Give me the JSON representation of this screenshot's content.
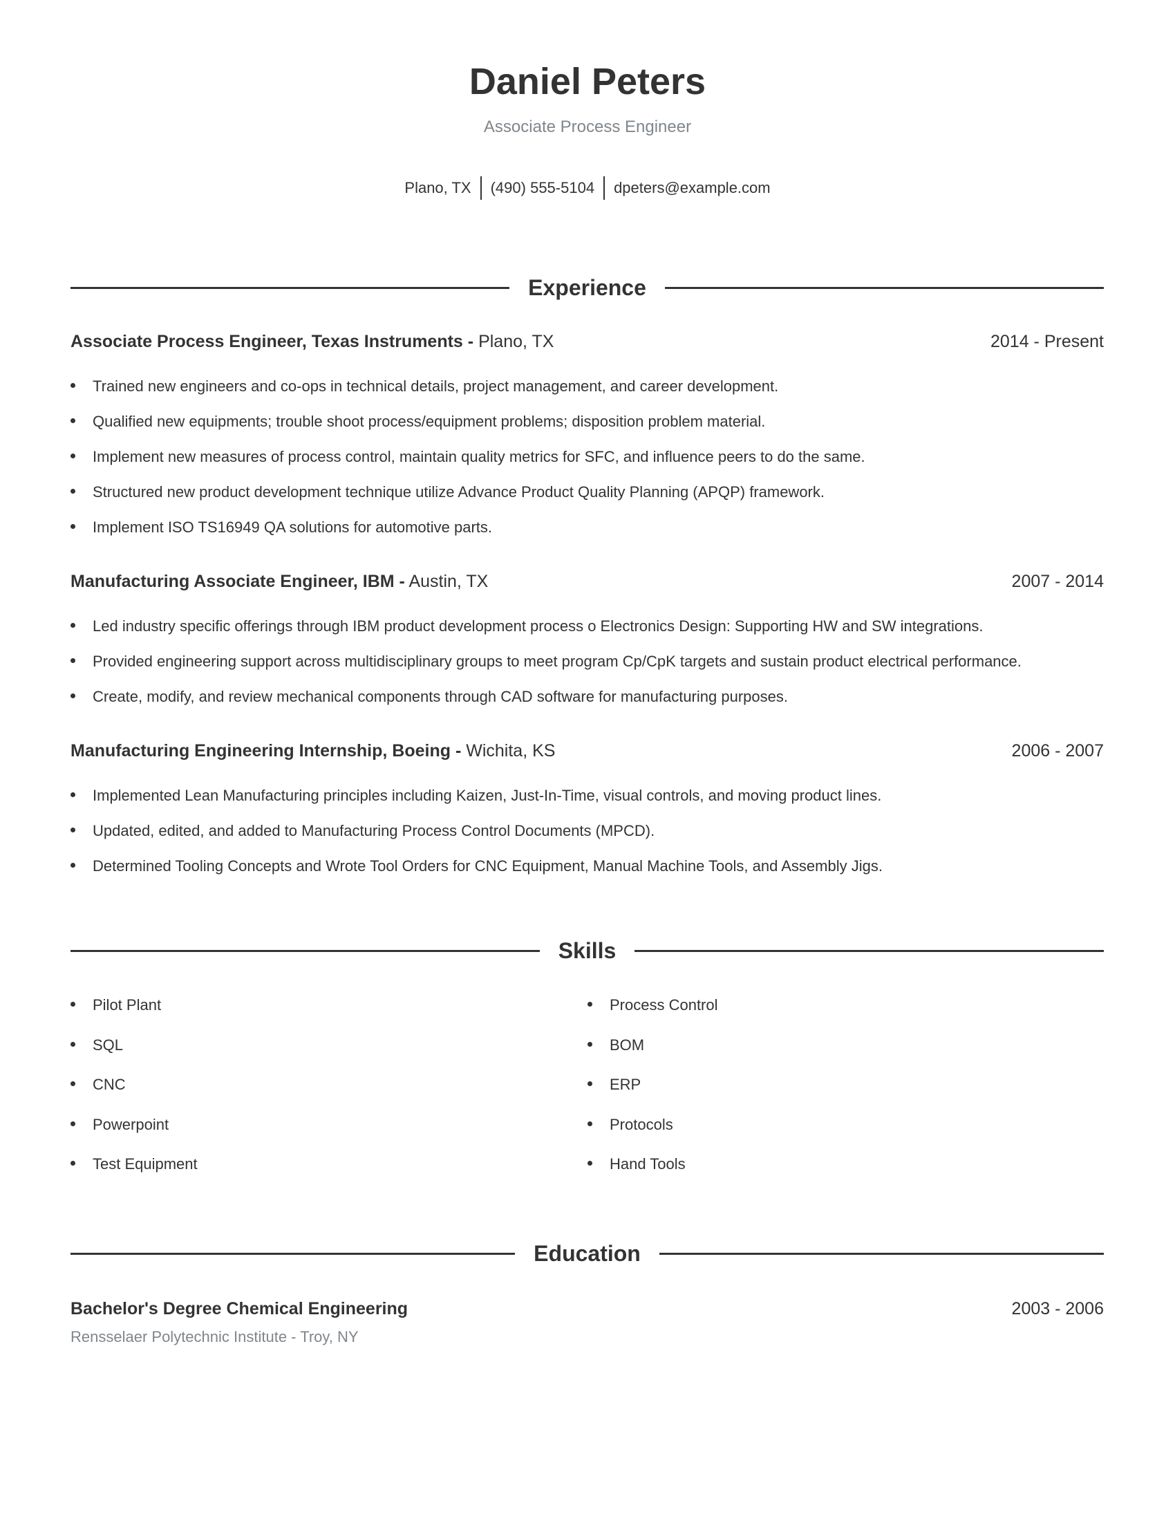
{
  "header": {
    "name": "Daniel Peters",
    "title": "Associate Process Engineer",
    "contact": {
      "location": "Plano, TX",
      "phone": "(490) 555-5104",
      "email": "dpeters@example.com"
    }
  },
  "sections": {
    "experience": "Experience",
    "skills": "Skills",
    "education": "Education"
  },
  "experience": [
    {
      "role": "Associate Process Engineer, Texas Instruments -",
      "location": "Plano, TX",
      "dates": "2014 - Present",
      "bullets": [
        "Trained new engineers and co-ops in technical details, project management, and career development.",
        "Qualified new equipments; trouble shoot process/equipment problems; disposition problem material.",
        "Implement new measures of process control, maintain quality metrics for SFC, and influence peers to do the same.",
        "Structured new product development technique utilize Advance Product Quality Planning (APQP) framework.",
        "Implement ISO TS16949 QA solutions for automotive parts."
      ]
    },
    {
      "role": "Manufacturing Associate Engineer, IBM -",
      "location": "Austin, TX",
      "dates": "2007 - 2014",
      "bullets": [
        "Led industry specific offerings through IBM product development process o Electronics Design: Supporting HW and SW integrations.",
        "Provided engineering support across multidisciplinary groups to meet program Cp/CpK targets and sustain product electrical performance.",
        "Create, modify, and review mechanical components through CAD software for manufacturing purposes."
      ]
    },
    {
      "role": "Manufacturing Engineering Internship, Boeing -",
      "location": "Wichita, KS",
      "dates": "2006 - 2007",
      "bullets": [
        "Implemented Lean Manufacturing principles including Kaizen, Just-In-Time, visual controls, and moving product lines.",
        "Updated, edited, and added to Manufacturing Process Control Documents (MPCD).",
        "Determined Tooling Concepts and Wrote Tool Orders for CNC Equipment, Manual Machine Tools, and Assembly Jigs."
      ]
    }
  ],
  "skills": {
    "left": [
      "Pilot Plant",
      "SQL",
      "CNC",
      "Powerpoint",
      "Test Equipment"
    ],
    "right": [
      "Process Control",
      "BOM",
      "ERP",
      "Protocols",
      "Hand Tools"
    ]
  },
  "education": [
    {
      "degree": "Bachelor's Degree Chemical Engineering",
      "dates": "2003 - 2006",
      "school": "Rensselaer Polytechnic Institute - Troy, NY"
    }
  ]
}
